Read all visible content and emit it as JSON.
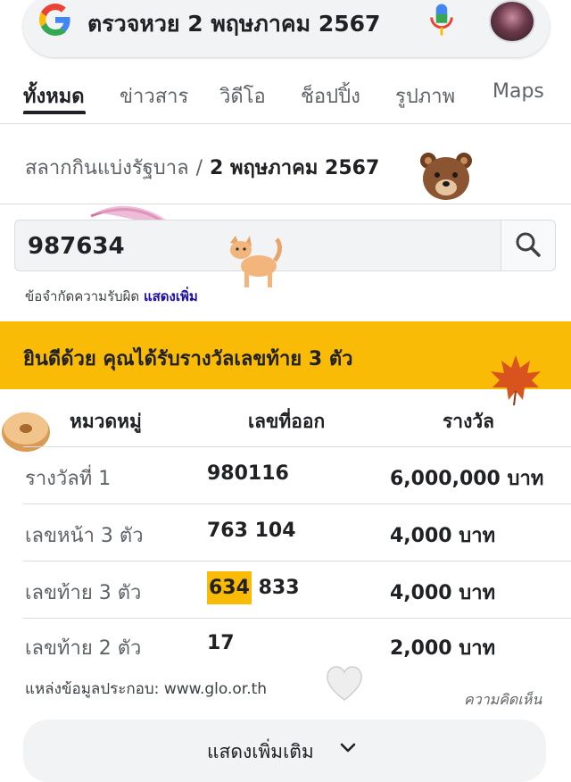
{
  "search": {
    "query": "ตรวจหวย 2 พฤษภาคม 2567"
  },
  "tabs": [
    {
      "label": "ทั้งหมด",
      "active": true
    },
    {
      "label": "ข่าวสาร"
    },
    {
      "label": "วิดีโอ"
    },
    {
      "label": "ช็อปปิ้ง"
    },
    {
      "label": "รูปภาพ"
    },
    {
      "label": "Maps"
    }
  ],
  "breadcrumb": {
    "source": "สลากกินแบ่งรัฐบาล",
    "separator": "/",
    "date": "2 พฤษภาคม 2567"
  },
  "checker": {
    "input_value": "987634",
    "disclaimer": "ข้อจำกัดความรับผิด",
    "disclaimer_link": "แสดงเพิ่ม"
  },
  "banner": {
    "text": "ยินดีด้วย คุณได้รับรางวัลเลขท้าย 3 ตัว"
  },
  "table": {
    "headers": [
      "หมวดหมู่",
      "เลขที่ออก",
      "รางวัล"
    ],
    "rows": [
      {
        "category": "รางวัลที่ 1",
        "numbers": "980116",
        "prize": "6,000,000 บาท"
      },
      {
        "category": "เลขหน้า 3 ตัว",
        "numbers": "763 104",
        "prize": "4,000 บาท"
      },
      {
        "category": "เลขท้าย 3 ตัว",
        "numbers_highlight": "634",
        "numbers_rest": "833",
        "prize": "4,000 บาท"
      },
      {
        "category": "เลขท้าย 2 ตัว",
        "numbers": "17",
        "prize": "2,000 บาท"
      }
    ]
  },
  "source": "แหล่งข้อมูลประกอบ: www.glo.or.th",
  "feedback": "ความคิดเห็น",
  "show_more": "แสดงเพิ่มเติม",
  "colors": {
    "highlight": "#f9bb06",
    "link": "#1a0dab"
  },
  "icons": [
    "google-logo-icon",
    "microphone-icon",
    "search-icon",
    "chevron-down-icon",
    "bear-sticker-icon",
    "cat-sticker-icon",
    "maple-leaf-sticker-icon",
    "bagel-sticker-icon",
    "heart-sticker-icon"
  ]
}
